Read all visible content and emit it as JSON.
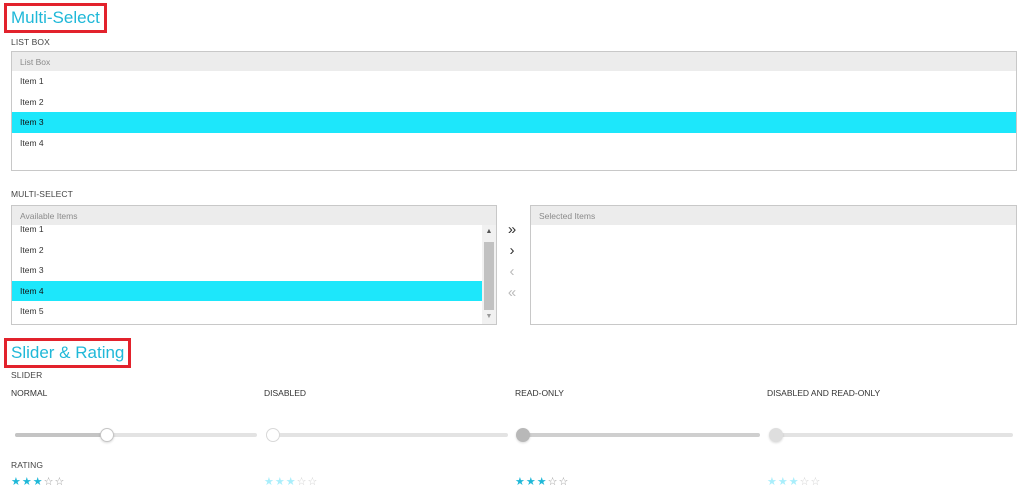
{
  "multi_select_section": {
    "title": "Multi-Select",
    "list_box_caption": "LIST BOX",
    "list_box": {
      "header": "List Box",
      "items": [
        "Item 1",
        "Item 2",
        "Item 3",
        "Item 4"
      ],
      "selected_index": 2
    },
    "multi_select_caption": "MULTI-SELECT",
    "available": {
      "header": "Available Items",
      "items": [
        "Item 1",
        "Item 2",
        "Item 3",
        "Item 4",
        "Item 5"
      ],
      "selected_index": 3
    },
    "selected": {
      "header": "Selected Items",
      "items": []
    },
    "move_buttons": {
      "move_all_right": "»",
      "move_right": "›",
      "move_left": "‹",
      "move_all_left": "«"
    },
    "scroll_up": "▲",
    "scroll_down": "▼"
  },
  "slider_section": {
    "title": "Slider & Rating",
    "slider_caption": "SLIDER",
    "rating_caption": "RATING",
    "sliders": [
      {
        "label": "NORMAL",
        "value": 0.38
      },
      {
        "label": "DISABLED",
        "value": 0.0
      },
      {
        "label": "READ-ONLY",
        "value": 0.0
      },
      {
        "label": "DISABLED AND READ-ONLY",
        "value": 0.0
      }
    ],
    "ratings": [
      {
        "value": 3,
        "max": 5
      },
      {
        "value": 3,
        "max": 5
      },
      {
        "value": 3,
        "max": 5
      },
      {
        "value": 3,
        "max": 5
      }
    ]
  },
  "colors": {
    "accent": "#1fb8d8",
    "selection": "#1de7fb",
    "highlight_border": "#e2222c"
  },
  "icons": {
    "full_star": "★",
    "empty_star": "☆"
  }
}
